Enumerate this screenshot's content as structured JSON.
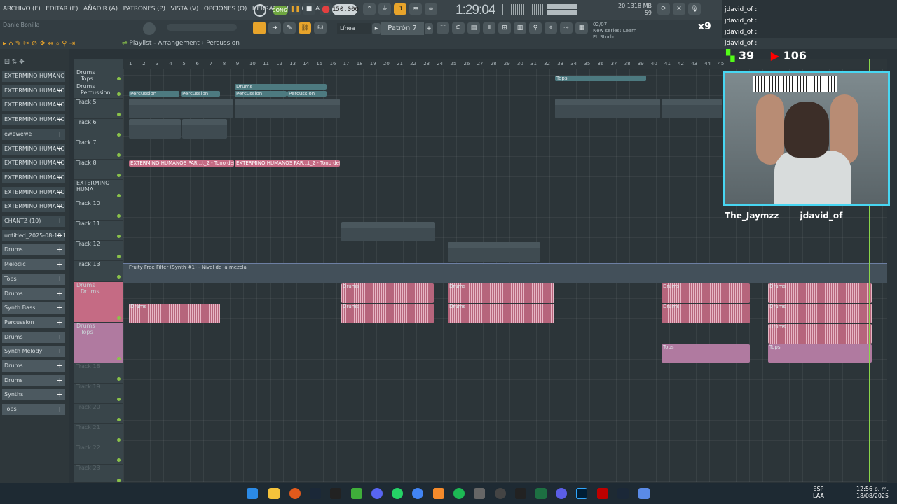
{
  "menu": [
    "ARCHIVO (F)",
    "EDITAR (E)",
    "AÑADIR (A)",
    "PATRONES (P)",
    "VISTA (V)",
    "OPCIONES (O)",
    "HERRAMIENTAS (T)",
    "AYUDA"
  ],
  "transport": {
    "mode": "SONG",
    "tempo": "150.000",
    "time": "1:29:04"
  },
  "cpu": {
    "line1": "20 1318 MB",
    "line2": "59"
  },
  "user": "DanielBonilla",
  "line_mode": "Línea",
  "pattern": "Patrón 7",
  "news": {
    "line1": "New series: Learn",
    "line2": "FL Studio",
    "date": "02/07"
  },
  "breadcrumb": {
    "title": "Playlist - Arrangement",
    "sub": "Percussion"
  },
  "browser": [
    "EXTERMINO HUMANO...",
    "EXTERMINO HUMANO...",
    "EXTERMINO HUMANO...",
    "EXTERMINO HUMANO...",
    "ewewewe",
    "EXTERMINO HUMANO...",
    "EXTERMINO HUMANO...",
    "EXTERMINO HUMANO...",
    "EXTERMINO HUMANO...",
    "EXTERMINO HUMANO...",
    "CHANTZ (10)",
    "untitled_2025-08-18 12-...",
    "Drums",
    "Melodic",
    "Tops",
    "Drums",
    "Synth Bass",
    "Percussion",
    "Drums",
    "Synth Melody",
    "Drums",
    "Drums",
    "Synths",
    "Tops"
  ],
  "tracks": [
    {
      "name": "Drums",
      "sub": "Tops"
    },
    {
      "name": "Drums",
      "sub": "Percussion"
    },
    {
      "name": "Track 5"
    },
    {
      "name": "Track 6"
    },
    {
      "name": "Track 7"
    },
    {
      "name": "Track 8"
    },
    {
      "name": "EXTERMINO HUMA"
    },
    {
      "name": "Track 10"
    },
    {
      "name": "Track 11"
    },
    {
      "name": "Track 12"
    },
    {
      "name": "Track 13"
    },
    {
      "name": "Drums",
      "sub": "Drums"
    },
    {
      "name": "Drums",
      "sub": "Tops"
    },
    {
      "name": "Track 18"
    },
    {
      "name": "Track 19"
    },
    {
      "name": "Track 20"
    },
    {
      "name": "Track 21"
    },
    {
      "name": "Track 22"
    },
    {
      "name": "Track 23"
    }
  ],
  "ruler": [
    "1",
    "2",
    "3",
    "4",
    "5",
    "6",
    "7",
    "8",
    "9",
    "10",
    "11",
    "12",
    "13",
    "14",
    "15",
    "16",
    "17",
    "18",
    "19",
    "20",
    "21",
    "22",
    "23",
    "24",
    "25",
    "26",
    "27",
    "28",
    "29",
    "30",
    "31",
    "32",
    "33",
    "34",
    "35",
    "36",
    "37",
    "38",
    "39",
    "40",
    "41",
    "42",
    "43",
    "44",
    "45"
  ],
  "clips": {
    "percussion": "Percussion",
    "drums": "Drums",
    "tops": "Tops",
    "patron1": "Patrón 1",
    "patron3": "Patrón 3",
    "patron4": "Patrón 4",
    "patron5": "Patrón 5",
    "extermino": "EXTERMINO HUMANOS PAR...t_2 - Tono del canal",
    "filter": "Fruity Free Filter (Synth #1) - Nivel de la mezcla"
  },
  "chat": [
    "jdavid_of :",
    "jdavid_of :",
    "jdavid_of :",
    "jdavid_of :"
  ],
  "stats": {
    "kick": "39",
    "yt": "106",
    "x": "x9"
  },
  "cam_names": {
    "left": "The_Jaymzz",
    "right": "jdavid_of"
  },
  "taskbar": {
    "lang1": "ESP",
    "lang2": "LAA",
    "time": "12:56 p. m.",
    "date": "18/08/2025"
  }
}
